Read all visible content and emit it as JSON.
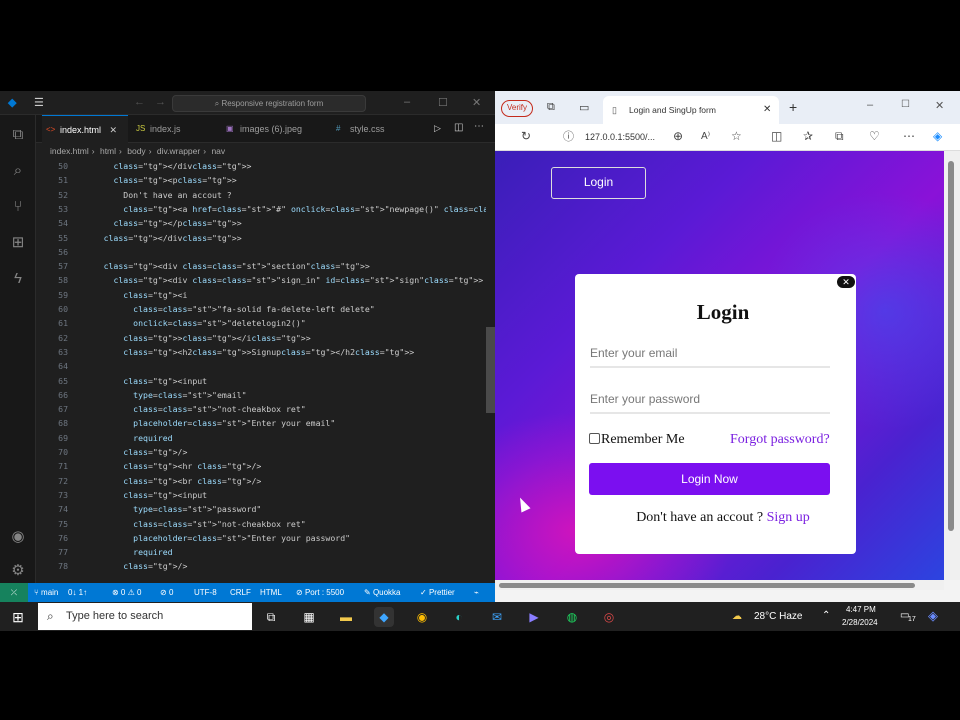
{
  "vscode": {
    "command_center": "Responsive registration form",
    "tabs": [
      {
        "label": "index.html",
        "icon": "html-icon",
        "color": "#e44d26"
      },
      {
        "label": "index.js",
        "icon": "js-icon",
        "color": "#cbcb41"
      },
      {
        "label": "images (6).jpeg",
        "icon": "image-icon",
        "color": "#a074c4"
      },
      {
        "label": "style.css",
        "icon": "css-icon",
        "color": "#519aba"
      }
    ],
    "breadcrumb": [
      "index.html",
      "html",
      "body",
      "div.wrapper",
      "nav"
    ],
    "line_numbers": [
      "50",
      "51",
      "52",
      "53",
      "54",
      "55",
      "56",
      "57",
      "58",
      "59",
      "60",
      "61",
      "62",
      "63",
      "64",
      "65",
      "66",
      "67",
      "68",
      "69",
      "70",
      "71",
      "72",
      "73",
      "74",
      "75",
      "76",
      "77",
      "78"
    ],
    "code_lines": [
      "        </div>",
      "        <p>",
      "          Don't have an accout ?",
      "          <a href=\"#\" onclick=\"newpage()\" class=\"last\">Sign up</a>",
      "        </p>",
      "      </div>",
      "",
      "      <div class=\"section\">",
      "        <div class=\"sign_in\" id=\"sign\">",
      "          <i",
      "            class=\"fa-solid fa-delete-left delete\"",
      "            onclick=\"deletelogin2()\"",
      "          ></i>",
      "          <h2>Signup</h2>",
      "",
      "          <input",
      "            type=\"email\"",
      "            class=\"not-cheakbox ret\"",
      "            placeholder=\"Enter your email\"",
      "            required",
      "          />",
      "          <hr />",
      "          <br />",
      "          <input",
      "            type=\"password\"",
      "            class=\"not-cheakbox ret\"",
      "            placeholder=\"Enter your password\"",
      "            required",
      "          />"
    ],
    "status": {
      "branch": "main",
      "sync": "0↓ 1↑",
      "problems": "⊗ 0 ⚠ 0",
      "ports": "0",
      "encoding": "UTF-8",
      "eol": "CRLF",
      "language": "HTML",
      "port": "Port : 5500",
      "quokka": "Quokka",
      "prettier": "Prettier"
    },
    "accent_color": "#0078d4"
  },
  "browser": {
    "verify_label": "Verify",
    "tab_title": "Login and SingUp form",
    "url": "127.0.0.1:5500/...",
    "page": {
      "nav_login": "Login",
      "card": {
        "title": "Login",
        "close_icon": "close-icon",
        "email_placeholder": "Enter your email",
        "password_placeholder": "Enter your password",
        "remember_label": "Remember Me",
        "forgot_label": "Forgot password?",
        "login_button": "Login Now",
        "signup_prompt": "Don't have an accout ?",
        "signup_link": "Sign up"
      },
      "accent_color": "#7b0ff0"
    }
  },
  "taskbar": {
    "search_placeholder": "Type here to search",
    "weather": "28°C  Haze",
    "time": "4:47 PM",
    "date": "2/28/2024",
    "notification_count": "17"
  }
}
